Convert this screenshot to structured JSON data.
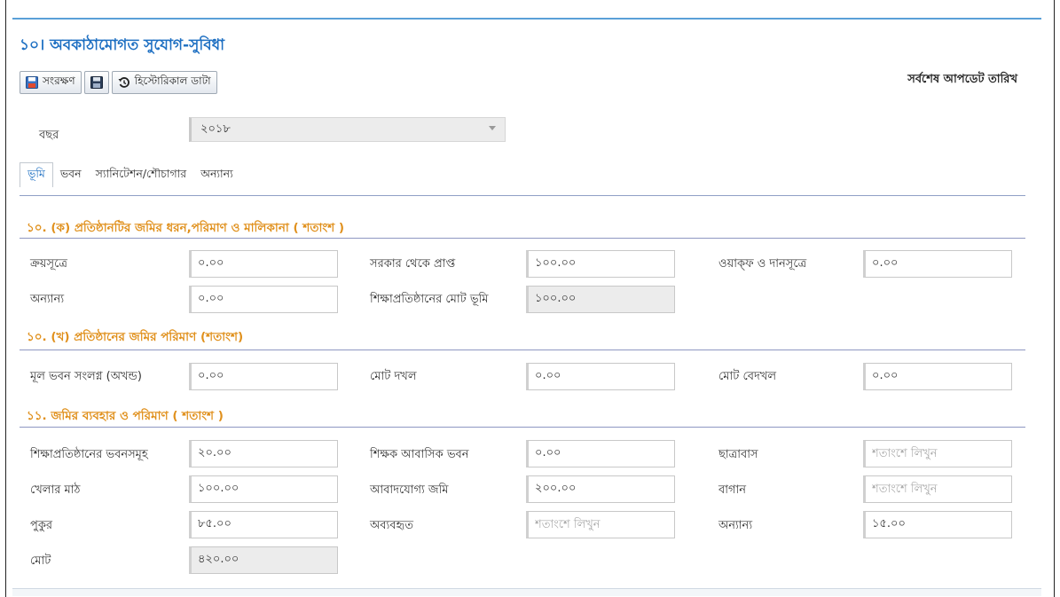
{
  "page": {
    "title": "১০। অবকাঠামোগত সুযোগ-সুবিধা",
    "last_update_label": "সর্বশেষ আপডেট তারিখ"
  },
  "toolbar": {
    "save_label": "সংরক্ষণ",
    "historical_label": "হিস্টোরিকাল ডাটা"
  },
  "year": {
    "label": "বছর",
    "value": "২০১৮"
  },
  "tabs": [
    {
      "label": "ভূমি",
      "active": true
    },
    {
      "label": "ভবন",
      "active": false
    },
    {
      "label": "স্যানিটেশন/শৌচাগার",
      "active": false
    },
    {
      "label": "অন্যান্য",
      "active": false
    }
  ],
  "sections": [
    {
      "title": "১০. (ক) প্রতিষ্ঠানটির জমির ধরন,পরিমাণ ও মালিকানা ( শতাংশ )",
      "fields": [
        {
          "label": "ক্রয়সূত্রে",
          "value": "০.০০",
          "placeholder": ""
        },
        {
          "label": "সরকার থেকে প্রাপ্ত",
          "value": "১০০.০০",
          "placeholder": ""
        },
        {
          "label": "ওয়াক্ফ ও দানসূত্রে",
          "value": "০.০০",
          "placeholder": ""
        },
        {
          "label": "অন্যান্য",
          "value": "০.০০",
          "placeholder": ""
        },
        {
          "label": "শিক্ষাপ্রতিষ্ঠানের মোট ভূমি",
          "value": "১০০.০০",
          "placeholder": "",
          "readonly": true
        }
      ]
    },
    {
      "title": "১০. (খ) প্রতিষ্ঠানের জমির পরিমাণ (শতাংশ)",
      "fields": [
        {
          "label": "মূল ভবন সংলগ্ন (অখন্ড)",
          "value": "০.০০",
          "placeholder": ""
        },
        {
          "label": "মোট দখল",
          "value": "০.০০",
          "placeholder": ""
        },
        {
          "label": "মোট বেদখল",
          "value": "০.০০",
          "placeholder": ""
        }
      ]
    },
    {
      "title": "১১. জমির ব্যবহার ও পরিমাণ ( শতাংশ )",
      "fields": [
        {
          "label": "শিক্ষাপ্রতিষ্ঠানের ভবনসমূহ",
          "value": "২০.০০",
          "placeholder": ""
        },
        {
          "label": "শিক্ষক আবাসিক ভবন",
          "value": "০.০০",
          "placeholder": ""
        },
        {
          "label": "ছাত্রাবাস",
          "value": "",
          "placeholder": "শতাংশে লিখুন"
        },
        {
          "label": "খেলার মাঠ",
          "value": "১০০.০০",
          "placeholder": ""
        },
        {
          "label": "আবাদযোগ্য জমি",
          "value": "২০০.০০",
          "placeholder": ""
        },
        {
          "label": "বাগান",
          "value": "",
          "placeholder": "শতাংশে লিখুন"
        },
        {
          "label": "পুকুর",
          "value": "৮৫.০০",
          "placeholder": ""
        },
        {
          "label": "অব্যবহৃত",
          "value": "",
          "placeholder": "শতাংশে লিখুন"
        },
        {
          "label": "অন্যান্য",
          "value": "১৫.০০",
          "placeholder": ""
        },
        {
          "label": "মোট",
          "value": "৪২০.০০",
          "placeholder": "",
          "readonly": true
        }
      ]
    }
  ]
}
